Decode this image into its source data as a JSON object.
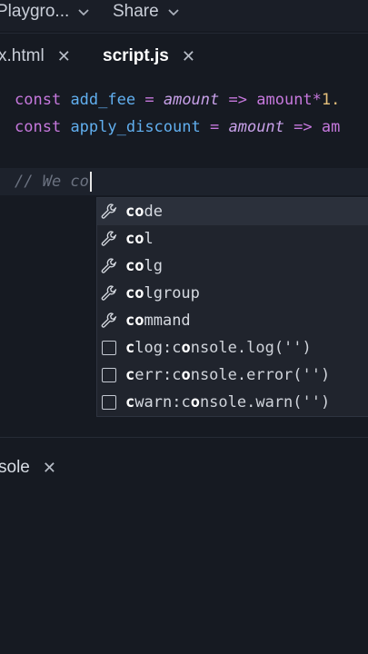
{
  "topbar": {
    "project_label": "Playgro...",
    "share_label": "Share"
  },
  "tabs": [
    {
      "label": "x.html",
      "active": false
    },
    {
      "label": "script.js",
      "active": true
    }
  ],
  "code": {
    "line1": {
      "kw": "const",
      "name": "add_fee",
      "eq": "=",
      "param": "amount",
      "arrow": "=>",
      "expr": "amount*",
      "num": "1."
    },
    "line2": {
      "kw": "const",
      "name": "apply_discount",
      "eq": "=",
      "param": "amount",
      "arrow": "=>",
      "expr": "am"
    },
    "comment": "// We co"
  },
  "suggestions": [
    {
      "icon": "wrench-icon",
      "match": "co",
      "rest": "de",
      "detail": ""
    },
    {
      "icon": "wrench-icon",
      "match": "co",
      "rest": "l",
      "detail": ""
    },
    {
      "icon": "wrench-icon",
      "match": "co",
      "rest": "lg",
      "detail": ""
    },
    {
      "icon": "wrench-icon",
      "match": "co",
      "rest": "lgroup",
      "detail": ""
    },
    {
      "icon": "wrench-icon",
      "match": "co",
      "rest": "mmand",
      "detail": ""
    },
    {
      "icon": "snippet-icon",
      "pre": "c",
      "match": "",
      "rest": "log: ",
      "detail": "console.log('')"
    },
    {
      "icon": "snippet-icon",
      "pre": "c",
      "match": "",
      "rest": "err: ",
      "detail": "console.error('')"
    },
    {
      "icon": "snippet-icon",
      "pre": "c",
      "match": "",
      "rest": "warn: ",
      "detail": "console.warn('')"
    }
  ],
  "console": {
    "tab_label": "sole"
  },
  "colors": {
    "background": "#161a22",
    "keyword": "#c678dd",
    "identifier": "#61afef",
    "number": "#e5c07b",
    "comment": "#6b7280"
  }
}
